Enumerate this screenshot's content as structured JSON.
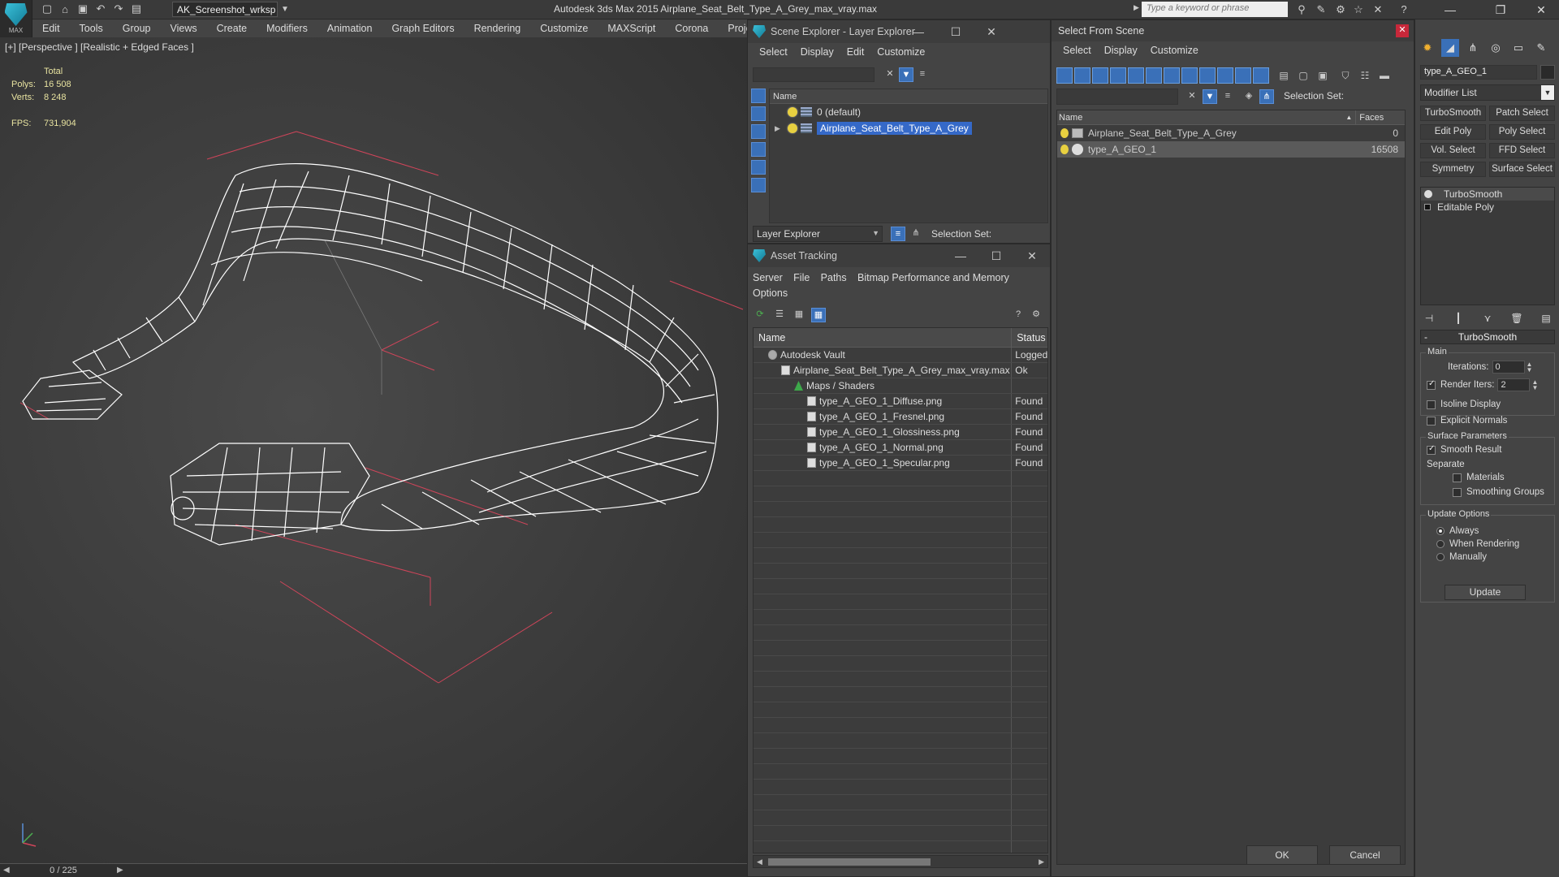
{
  "app": {
    "logo_text": "MAX",
    "workspace": "AK_Screenshot_wrksp",
    "title": "Autodesk 3ds Max  2015     Airplane_Seat_Belt_Type_A_Grey_max_vray.max",
    "search_placeholder": "Type a keyword or phrase"
  },
  "menu": [
    "Edit",
    "Tools",
    "Group",
    "Views",
    "Create",
    "Modifiers",
    "Animation",
    "Graph Editors",
    "Rendering",
    "Customize",
    "MAXScript",
    "Corona",
    "Project Man"
  ],
  "viewport": {
    "label": "[+] [Perspective ] [Realistic + Edged Faces ]",
    "stats_header": "Total",
    "polys_label": "Polys:",
    "polys_value": "16 508",
    "verts_label": "Verts:",
    "verts_value": "8 248",
    "fps_label": "FPS:",
    "fps_value": "731,904"
  },
  "timeline": {
    "frame_counter": "0 / 225"
  },
  "scene_explorer": {
    "title": "Scene Explorer - Layer Explorer",
    "menu": [
      "Select",
      "Display",
      "Edit",
      "Customize"
    ],
    "column_name": "Name",
    "rows": [
      {
        "label": "0 (default)",
        "selected": false
      },
      {
        "label": "Airplane_Seat_Belt_Type_A_Grey",
        "selected": true
      }
    ],
    "footer_dropdown": "Layer Explorer",
    "selection_set_label": "Selection Set:"
  },
  "asset_tracking": {
    "title": "Asset Tracking",
    "menu": [
      "Server",
      "File",
      "Paths",
      "Bitmap Performance and Memory",
      "Options"
    ],
    "columns": [
      "Name",
      "Status"
    ],
    "rows": [
      {
        "name": "Autodesk Vault",
        "status": "Logged",
        "indent": 1,
        "icon": "vault-icon"
      },
      {
        "name": "Airplane_Seat_Belt_Type_A_Grey_max_vray.max",
        "status": "Ok",
        "indent": 2,
        "icon": "file-icon"
      },
      {
        "name": "Maps / Shaders",
        "status": "",
        "indent": 3,
        "icon": "maps-icon"
      },
      {
        "name": "type_A_GEO_1_Diffuse.png",
        "status": "Found",
        "indent": 4,
        "icon": "image-icon"
      },
      {
        "name": "type_A_GEO_1_Fresnel.png",
        "status": "Found",
        "indent": 4,
        "icon": "image-icon"
      },
      {
        "name": "type_A_GEO_1_Glossiness.png",
        "status": "Found",
        "indent": 4,
        "icon": "image-icon"
      },
      {
        "name": "type_A_GEO_1_Normal.png",
        "status": "Found",
        "indent": 4,
        "icon": "image-icon"
      },
      {
        "name": "type_A_GEO_1_Specular.png",
        "status": "Found",
        "indent": 4,
        "icon": "image-icon"
      }
    ]
  },
  "select_from_scene": {
    "title": "Select From Scene",
    "menu": [
      "Select",
      "Display",
      "Customize"
    ],
    "selection_set_label": "Selection Set:",
    "columns": [
      "Name",
      "Faces"
    ],
    "rows": [
      {
        "name": "Airplane_Seat_Belt_Type_A_Grey",
        "faces": "0",
        "selected": false,
        "icon": "group-icon"
      },
      {
        "name": "type_A_GEO_1",
        "faces": "16508",
        "selected": true,
        "icon": "geometry-icon"
      }
    ],
    "ok_label": "OK",
    "cancel_label": "Cancel"
  },
  "command_panel": {
    "object_name": "type_A_GEO_1",
    "modifier_list": "Modifier List",
    "modifier_buttons": [
      "TurboSmooth",
      "Patch Select",
      "Edit Poly",
      "Poly Select",
      "Vol. Select",
      "FFD Select",
      "Symmetry",
      "Surface Select"
    ],
    "stack": [
      "TurboSmooth",
      "Editable Poly"
    ],
    "rollout_title": "TurboSmooth",
    "main_label": "Main",
    "iterations_label": "Iterations:",
    "iterations_value": "0",
    "render_iters_label": "Render Iters:",
    "render_iters_value": "2",
    "render_iters_checked": true,
    "isoline_label": "Isoline Display",
    "explicit_normals_label": "Explicit Normals",
    "surface_params_label": "Surface Parameters",
    "smooth_result_label": "Smooth Result",
    "separate_label": "Separate",
    "materials_label": "Materials",
    "smoothing_groups_label": "Smoothing Groups",
    "update_options_label": "Update Options",
    "always_label": "Always",
    "when_rendering_label": "When Rendering",
    "manually_label": "Manually",
    "update_button": "Update"
  },
  "colors": {
    "selection_blue": "#3569c8",
    "stats_yellow": "#e8e3a0",
    "grid_red": "#d0455a",
    "close_red": "#c8283a"
  }
}
